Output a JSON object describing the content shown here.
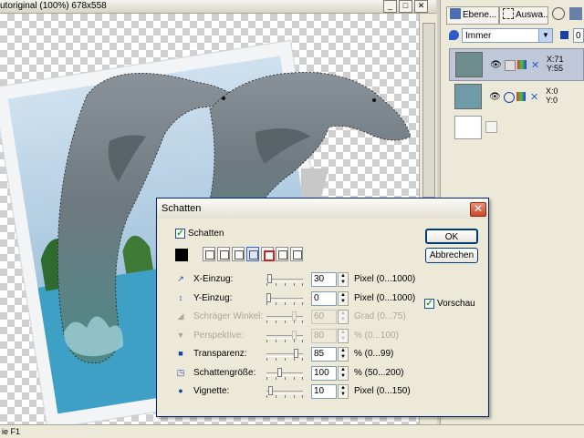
{
  "document": {
    "title": "utoriginal (100%) 678x558",
    "win_buttons": [
      "_",
      "□",
      "✕"
    ]
  },
  "status": {
    "text": "ie F1"
  },
  "layers_panel": {
    "tabs": [
      {
        "label": "Ebene..."
      },
      {
        "label": "Auswa..."
      }
    ],
    "mode": "Immer",
    "opacity_field": "0",
    "layers": [
      {
        "x": "X:71",
        "y": "Y:55"
      },
      {
        "x": "X:0",
        "y": "Y:0"
      }
    ]
  },
  "dialog": {
    "title": "Schatten",
    "close_glyph": "✕",
    "shadow_enabled_label": "Schatten",
    "ok_label": "OK",
    "cancel_label": "Abbrechen",
    "preview_label": "Vorschau",
    "shadow_color": "#000000",
    "rows": [
      {
        "label": "X-Einzug:",
        "value": "30",
        "range": "Pixel (0...1000)",
        "enabled": true,
        "slider": 0.03
      },
      {
        "label": "Y-Einzug:",
        "value": "0",
        "range": "Pixel (0...1000)",
        "enabled": true,
        "slider": 0.0
      },
      {
        "label": "Schräger Winkel:",
        "value": "60",
        "range": "Grad (0...75)",
        "enabled": false,
        "slider": 0.8
      },
      {
        "label": "Perspektive:",
        "value": "80",
        "range": "% (0...100)",
        "enabled": false,
        "slider": 0.8
      },
      {
        "label": "Transparenz:",
        "value": "85",
        "range": "% (0...99)",
        "enabled": true,
        "slider": 0.86
      },
      {
        "label": "Schattengröße:",
        "value": "100",
        "range": "% (50...200)",
        "enabled": true,
        "slider": 0.33
      },
      {
        "label": "Vignette:",
        "value": "10",
        "range": "Pixel (0...150)",
        "enabled": true,
        "slider": 0.07
      }
    ]
  }
}
